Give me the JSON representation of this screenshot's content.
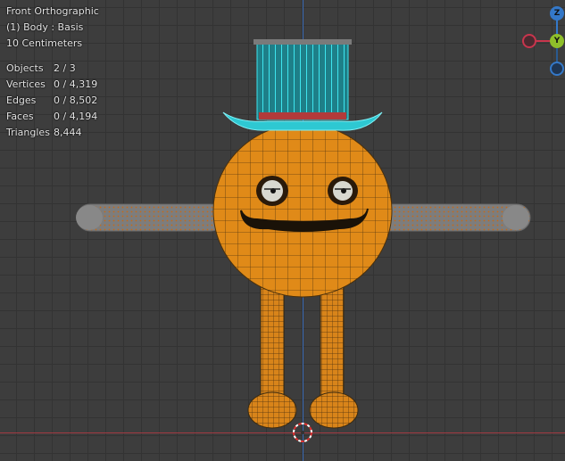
{
  "viewport": {
    "view_name": "Front Orthographic",
    "active_object": "(1) Body : Basis",
    "grid_scale": "10 Centimeters"
  },
  "stats": [
    {
      "label": "Objects",
      "value": "2 / 3"
    },
    {
      "label": "Vertices",
      "value": "0 / 4,319"
    },
    {
      "label": "Edges",
      "value": "0 / 8,502"
    },
    {
      "label": "Faces",
      "value": "0 / 4,194"
    },
    {
      "label": "Triangles",
      "value": "8,444"
    }
  ],
  "gizmo": {
    "z_label": "Z",
    "y_label": "Y",
    "colors": {
      "x": "#c8354d",
      "y": "#8fbf2a",
      "z": "#3478c8"
    }
  },
  "colors": {
    "body": "#e08a18",
    "hat": "#2ec8d2",
    "arm": "#8a8a8a",
    "mouth": "#1a1208",
    "cursor": "#e03030"
  }
}
